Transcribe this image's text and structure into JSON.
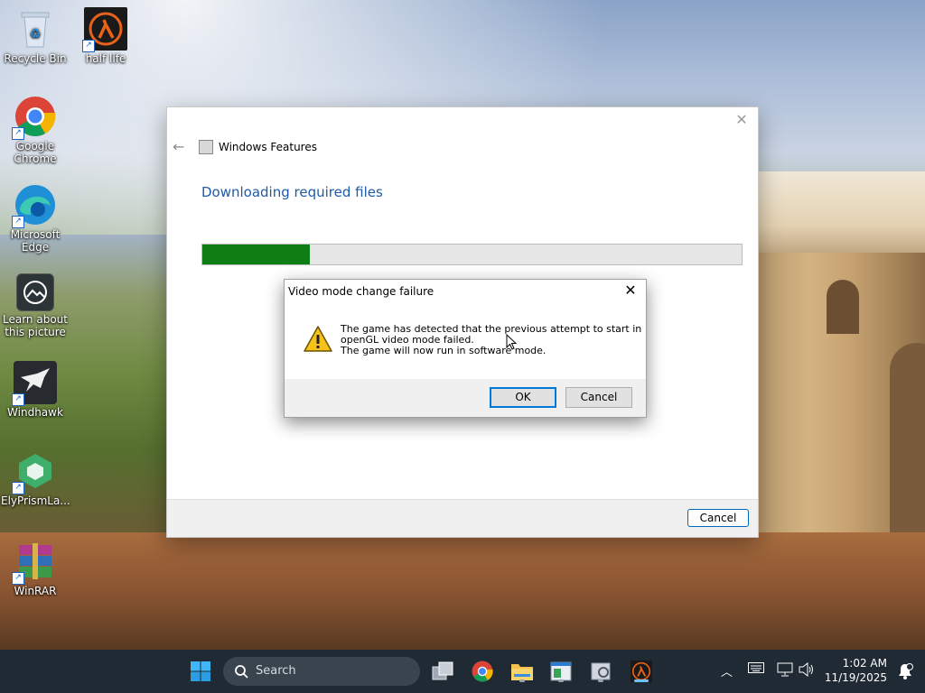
{
  "desktop": {
    "icons": [
      {
        "label": "Recycle Bin"
      },
      {
        "label": "half life"
      },
      {
        "label": "Google Chrome"
      },
      {
        "label": "Microsoft Edge"
      },
      {
        "label": "Learn about this picture"
      },
      {
        "label": "Windhawk"
      },
      {
        "label": "ElyPrismLa..."
      },
      {
        "label": "WinRAR"
      }
    ]
  },
  "windows_features": {
    "title": "Windows Features",
    "heading": "Downloading required files",
    "progress_fraction": 0.2,
    "cancel_label": "Cancel"
  },
  "dialog": {
    "title": "Video mode change failure",
    "message": "The game has detected that the previous attempt to start in\nopenGL video mode failed.\nThe game will now run in software mode.",
    "ok_label": "OK",
    "cancel_label": "Cancel"
  },
  "taskbar": {
    "search_label": "Search",
    "time": "1:02 AM",
    "date": "11/19/2025"
  },
  "colors": {
    "accent": "#0078d7",
    "progress": "#0e7d13",
    "heading": "#1e5aa8",
    "taskbar": "#1f2a35"
  }
}
